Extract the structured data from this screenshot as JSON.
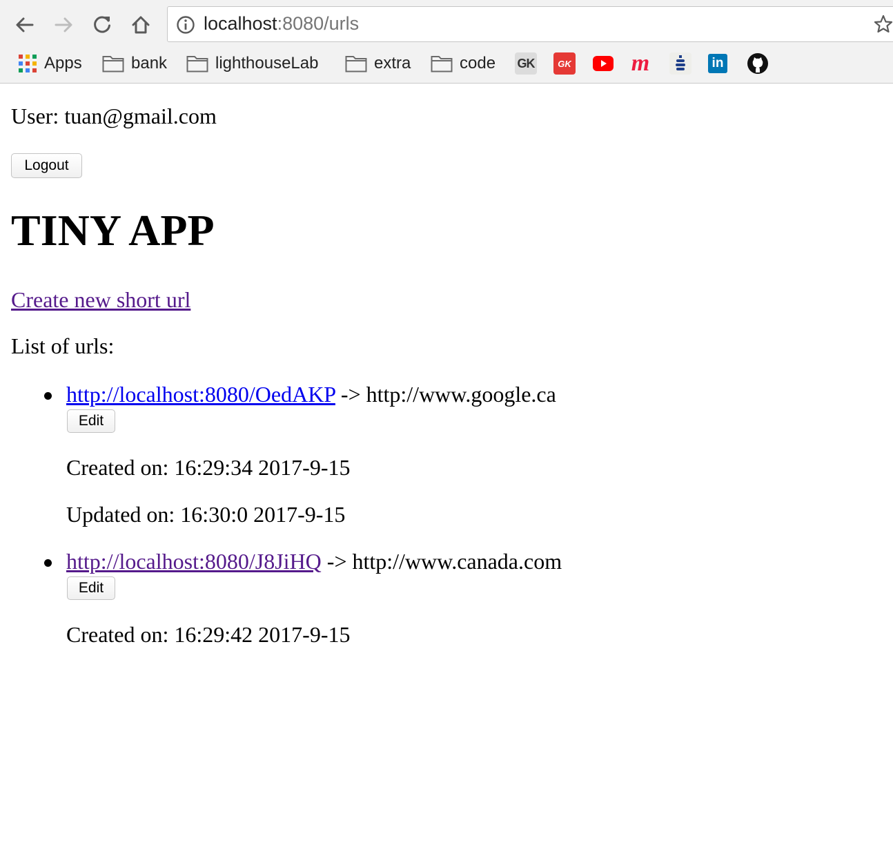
{
  "browser": {
    "url_host": "localhost",
    "url_rest": ":8080/urls",
    "bookmarks": [
      {
        "label": "Apps",
        "icon": "apps-grid-icon"
      },
      {
        "label": "bank",
        "icon": "folder-icon"
      },
      {
        "label": "lighthouseLab",
        "icon": "folder-icon"
      },
      {
        "label": "extra",
        "icon": "folder-icon"
      },
      {
        "label": "code",
        "icon": "folder-icon"
      }
    ],
    "favicons": [
      {
        "icon": "gk-icon",
        "text": "GK",
        "color": "#e0e0e0"
      },
      {
        "icon": "gk-red-icon",
        "text": "GK",
        "color": "#e53935"
      },
      {
        "icon": "youtube-icon",
        "color": "#ff0000"
      },
      {
        "icon": "meetup-icon",
        "text": "m",
        "color": "#ed1c40"
      },
      {
        "icon": "stack-icon",
        "color": "#1e3f8a"
      },
      {
        "icon": "linkedin-icon",
        "text": "in",
        "color": "#0077b5"
      },
      {
        "icon": "github-icon",
        "color": "#111111"
      }
    ]
  },
  "page": {
    "user_line": "User: tuan@gmail.com",
    "logout_label": "Logout",
    "title": "TINY APP",
    "create_link": "Create new short url",
    "list_label": "List of urls:",
    "urls": [
      {
        "short_url": "http://localhost:8080/OedAKP",
        "long_url": " -> http://www.google.ca",
        "edit_label": "Edit",
        "created": "Created on: 16:29:34 2017-9-15",
        "updated": "Updated on: 16:30:0 2017-9-15"
      },
      {
        "short_url": "http://localhost:8080/J8JiHQ",
        "long_url": " -> http://www.canada.com",
        "edit_label": "Edit",
        "created": "Created on: 16:29:42 2017-9-15"
      }
    ]
  },
  "colors": {
    "visited_link": "#551a8b",
    "link": "#0000ee",
    "chrome_bg": "#f2f2f2"
  }
}
